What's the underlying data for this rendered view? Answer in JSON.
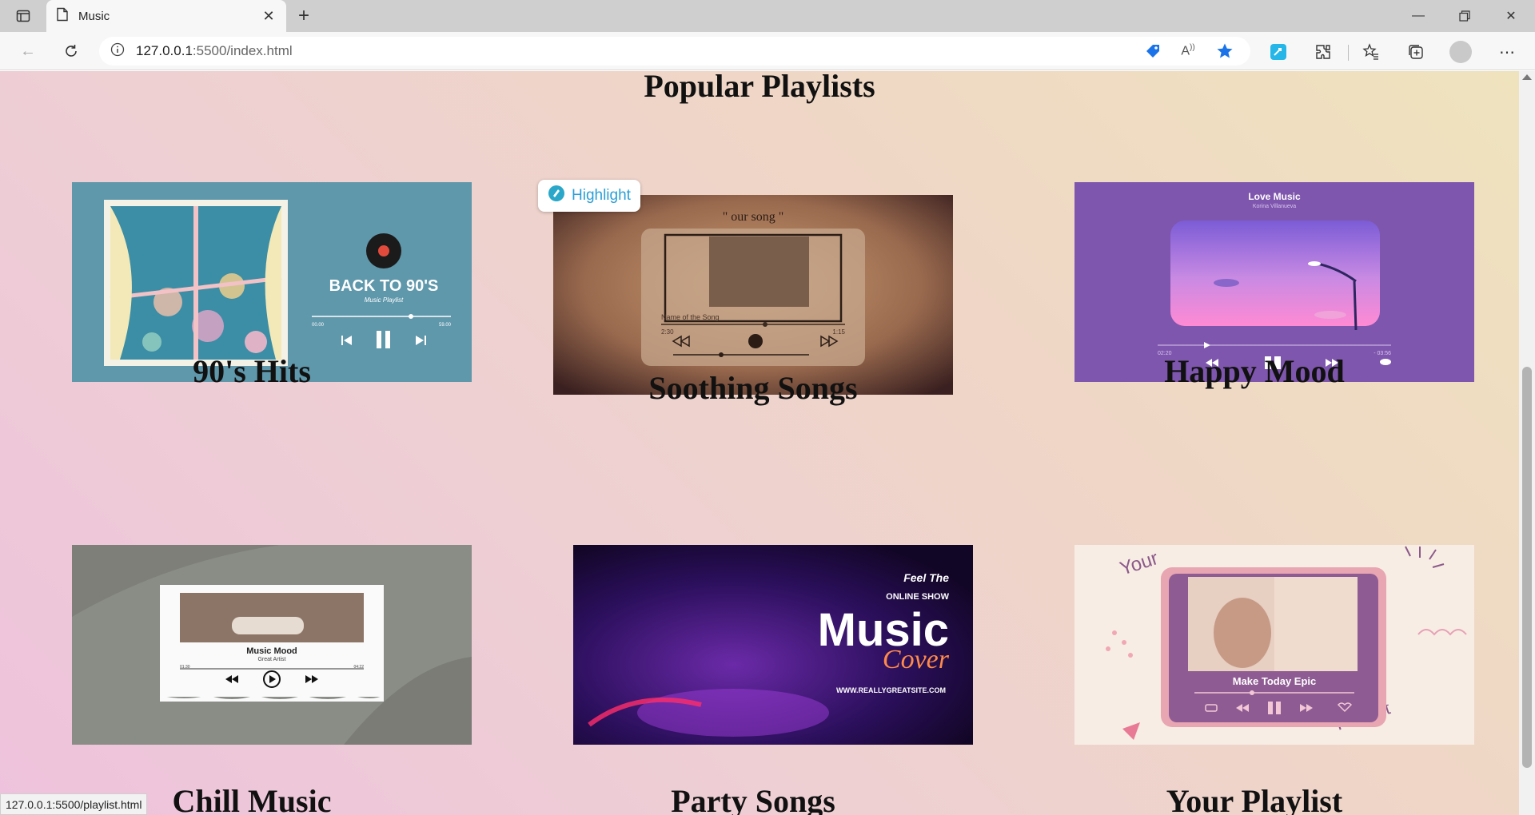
{
  "browser": {
    "tab_title": "Music",
    "url_host": "127.0.0.1",
    "url_rest": ":5500/index.html",
    "status_url": "127.0.0.1:5500/playlist.html"
  },
  "page": {
    "section_title": "Popular Playlists",
    "highlight_label": "Highlight",
    "playlists": [
      {
        "label": "90's Hits",
        "cover_title": "BACK TO 90'S",
        "cover_subtitle": "Music Playlist",
        "time_start": "00.00",
        "time_end": "59.00"
      },
      {
        "label": "Soothing Songs",
        "cover_title": "\" our song \"",
        "cover_subtitle": "Name of the Song",
        "time_start": "2:30",
        "time_end": "1:15"
      },
      {
        "label": "Happy Mood",
        "cover_title": "Love Music",
        "cover_subtitle": "Korina Villanueva",
        "time_start": "02:20",
        "time_end": "- 03:56"
      },
      {
        "label": "Chill Music",
        "cover_title": "Music Mood",
        "cover_subtitle": "Great Artist",
        "time_start": "01:30",
        "time_end": "04:22"
      },
      {
        "label": "Party Songs",
        "cover_title": "Music",
        "cover_line1": "Feel The",
        "cover_line2": "ONLINE SHOW",
        "cover_script": "Cover",
        "cover_site": "WWW.REALLYGREATSITE.COM"
      },
      {
        "label": "Your Playlist",
        "cover_title": "Make Today Epic",
        "cover_top": "Your",
        "cover_bottom": "Playlist"
      }
    ]
  },
  "colors": {
    "accent_blue": "#1a73e8",
    "highlight_teal": "#2a9fd6"
  }
}
